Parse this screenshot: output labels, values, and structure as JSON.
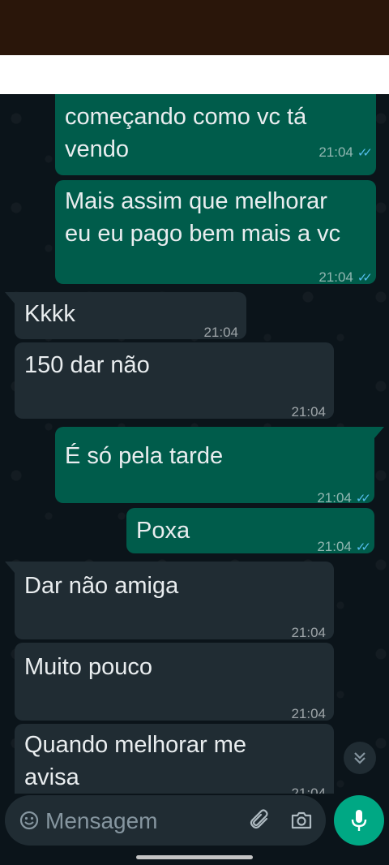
{
  "colors": {
    "outgoing": "#005c4b",
    "incoming": "#202c33",
    "read_ticks": "#53bdeb",
    "send": "#00a884"
  },
  "messages": [
    {
      "direction": "out",
      "text": "começando como vc tá\nvendo",
      "time": "21:04",
      "status": "read"
    },
    {
      "direction": "out",
      "text": "Mais assim que melhorar\neu eu pago bem mais a vc",
      "time": "21:04",
      "status": "read"
    },
    {
      "direction": "in",
      "text": "Kkkk",
      "time": "21:04"
    },
    {
      "direction": "in",
      "text": "150 dar não",
      "time": "21:04"
    },
    {
      "direction": "out",
      "text": "É só pela tarde",
      "time": "21:04",
      "status": "read"
    },
    {
      "direction": "out",
      "text": "Poxa",
      "time": "21:04",
      "status": "read"
    },
    {
      "direction": "in",
      "text": "Dar não amiga",
      "time": "21:04"
    },
    {
      "direction": "in",
      "text": "Muito pouco",
      "time": "21:04"
    },
    {
      "direction": "in",
      "text": "Quando melhorar me\navisa",
      "time": "21:04"
    }
  ],
  "composer": {
    "placeholder": "Mensagem",
    "icons": [
      "emoji-icon",
      "attach-icon",
      "camera-icon",
      "mic-icon"
    ]
  },
  "scroll_down_icon": "chevron-double-down-icon"
}
